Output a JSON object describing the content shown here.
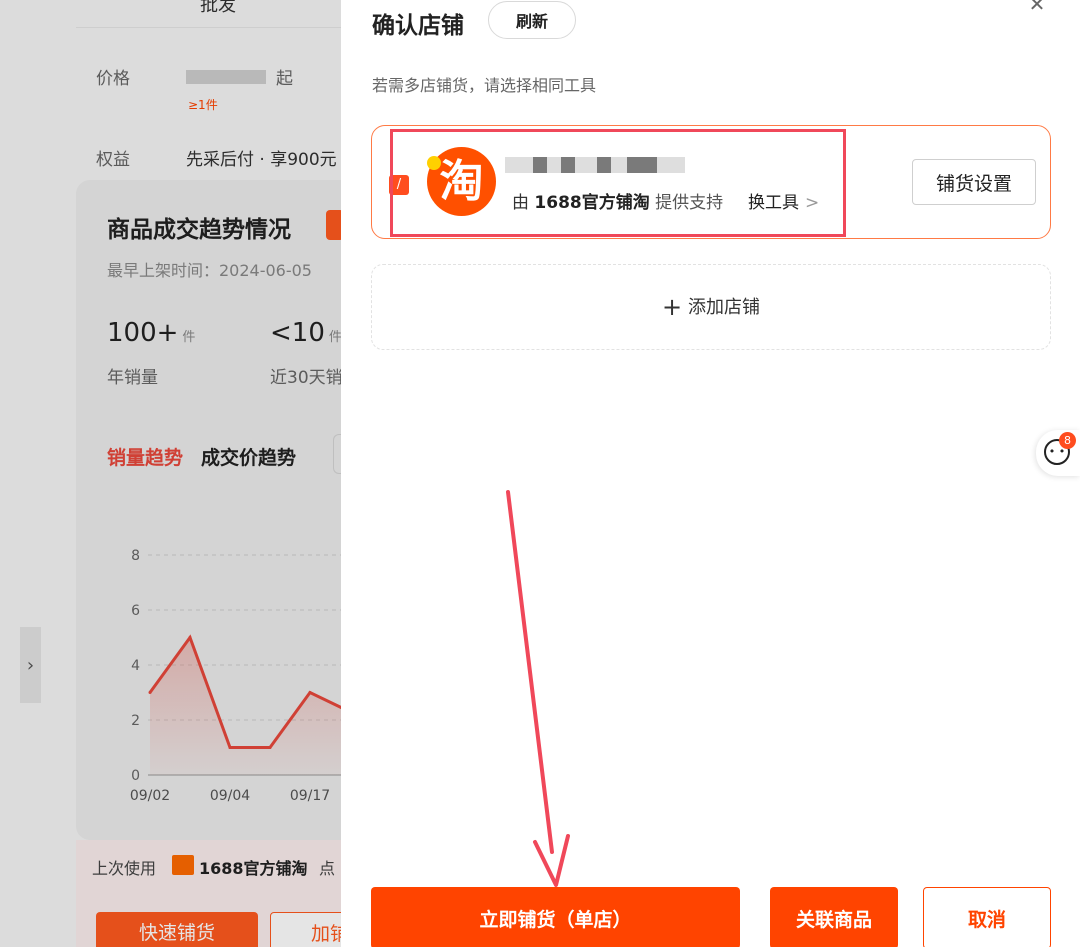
{
  "background": {
    "tab_partial": "批发",
    "price_label": "价格",
    "price_suffix": "起",
    "min_qty": "≥1件",
    "rights_label": "权益",
    "rights_value": "先采后付 · 享900元",
    "trend_title": "商品成交趋势情况",
    "listed_date": "最早上架时间：2024-06-05",
    "stat1_value": "100+",
    "stat1_unit": "件",
    "stat1_label": "年销量",
    "stat2_value": "<10",
    "stat2_unit": "件",
    "stat2_label": "近30天销",
    "tab_sales": "销量趋势",
    "tab_price": "成交价趋势",
    "last_used_prefix": "上次使用",
    "last_used_tool": "1688官方铺淘",
    "last_used_suffix": "点",
    "fast_btn": "快速铺货",
    "add_btn": "加铺",
    "side_handle_icon": "chevron-right-icon"
  },
  "chart_data": {
    "type": "area",
    "categories": [
      "09/02",
      "09/04",
      "09/17"
    ],
    "x": [
      "09/02",
      "",
      "09/04",
      "",
      "09/17",
      ""
    ],
    "values": [
      3,
      5,
      1,
      1,
      3,
      2.3
    ],
    "y_ticks": [
      "0",
      "2",
      "4",
      "6",
      "8"
    ],
    "ylim": [
      0,
      8
    ],
    "grid": true,
    "color": "#e8483b"
  },
  "drawer": {
    "title": "确认店铺",
    "refresh_label": "刷新",
    "close_icon": "close-icon",
    "hint": "若需多店铺货，请选择相同工具",
    "shop": {
      "checkbox_mark": "/",
      "logo_char": "淘",
      "support_prefix": "由",
      "support_tool": "1688官方铺淘",
      "support_suffix": "提供支持",
      "switch_label": "换工具",
      "switch_chevron": ">",
      "settings_label": "铺货设置"
    },
    "add_shop_plus": "+",
    "add_shop_label": "添加店铺",
    "primary_label": "立即铺货（单店）",
    "link_label": "关联商品",
    "cancel_label": "取消"
  },
  "floating": {
    "icon": "cat-face-icon",
    "badge": "8"
  },
  "colors": {
    "accent": "#ff4400",
    "highlight": "#f0485a",
    "taobao": "#ff5000"
  }
}
